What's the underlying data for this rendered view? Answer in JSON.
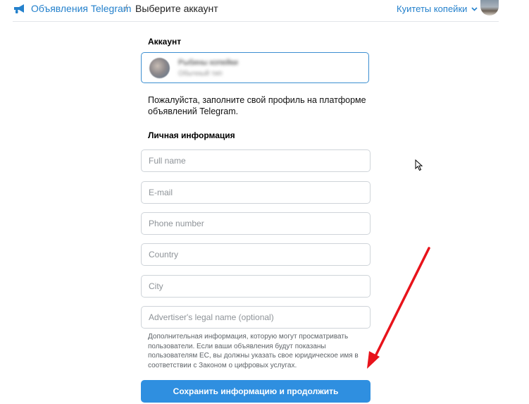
{
  "header": {
    "brand": "Объявления Telegram",
    "separator": "/",
    "page_title": "Выберите аккаунт",
    "account_menu_label": "Куитеты копейки"
  },
  "account_section": {
    "title": "Аккаунт",
    "selected_name": "Рыбины копейки",
    "selected_subtitle": "Обычный тип"
  },
  "intro_text": "Пожалуйста, заполните свой профиль на платформе объявлений Telegram.",
  "personal_section": {
    "title": "Личная информация",
    "fields": {
      "full_name_placeholder": "Full name",
      "email_placeholder": "E-mail",
      "phone_placeholder": "Phone number",
      "country_placeholder": "Country",
      "city_placeholder": "City",
      "legal_name_placeholder": "Advertiser's legal name (optional)"
    },
    "hint": "Дополнительная информация, которую могут просматривать пользователи. Если ваши объявления будут показаны пользователям ЕС, вы должны указать свое юридическое имя в соответствии с Законом о цифровых услугах."
  },
  "submit_label": "Сохранить информацию и продолжить",
  "colors": {
    "accent": "#2481cc",
    "button": "#2f8fe0",
    "annotation_arrow": "#e8131b"
  },
  "icons": {
    "logo": "megaphone-icon",
    "menu_chevron": "chevron-down-icon",
    "cursor": "mouse-pointer-icon",
    "annotation": "red-arrow-icon"
  }
}
